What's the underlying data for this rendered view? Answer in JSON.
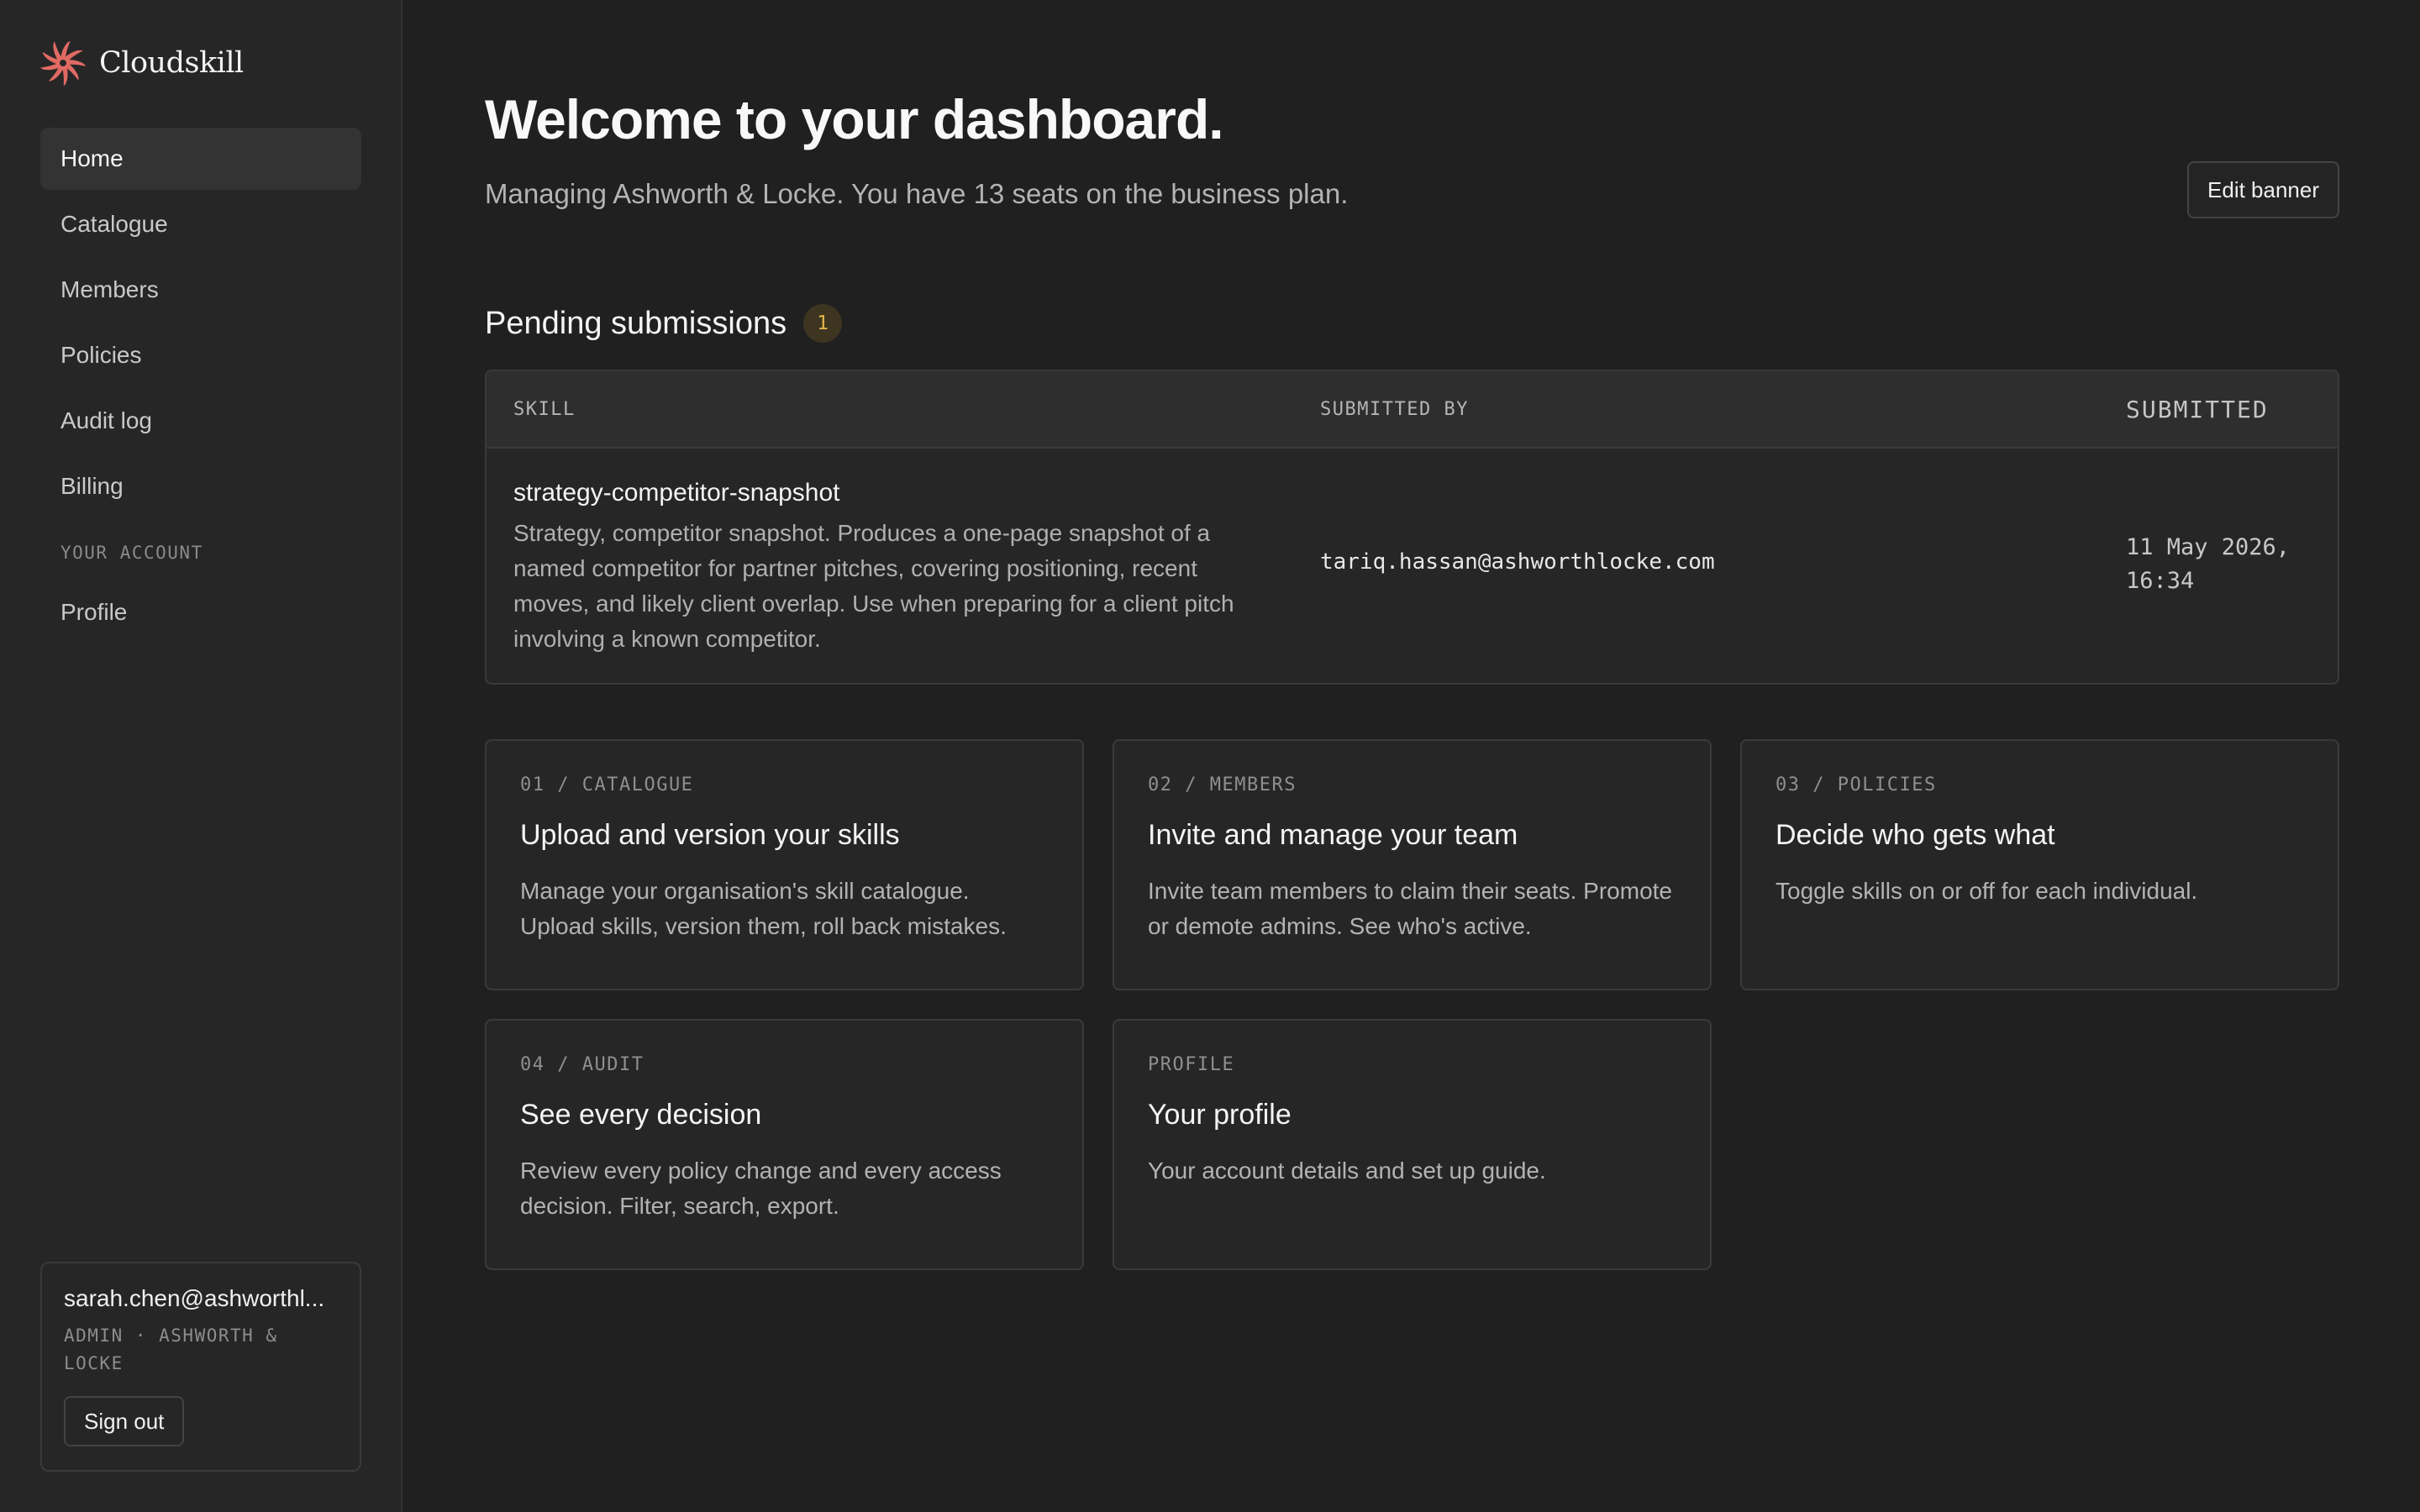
{
  "brand": {
    "name": "Cloudskill",
    "logo_icon": "cloudskill-logo-icon",
    "logo_color": "#e06a63"
  },
  "nav": {
    "items": [
      {
        "label": "Home",
        "active": true
      },
      {
        "label": "Catalogue"
      },
      {
        "label": "Members"
      },
      {
        "label": "Policies"
      },
      {
        "label": "Audit log"
      },
      {
        "label": "Billing"
      }
    ],
    "account_section_label": "YOUR ACCOUNT",
    "account_items": [
      {
        "label": "Profile"
      }
    ]
  },
  "account": {
    "email": "sarah.chen@ashworthl...",
    "role": "ADMIN · ASHWORTH & LOCKE",
    "sign_out_label": "Sign out"
  },
  "header": {
    "title": "Welcome to your dashboard.",
    "subtitle": "Managing Ashworth & Locke. You have 13 seats on the business plan.",
    "edit_banner_label": "Edit banner"
  },
  "pending": {
    "title": "Pending submissions",
    "count": "1",
    "columns": {
      "skill": "SKILL",
      "submitted_by": "SUBMITTED BY",
      "submitted": "SUBMITTED"
    },
    "rows": [
      {
        "skill": "strategy-competitor-snapshot",
        "description": "Strategy, competitor snapshot. Produces a one-page snapshot of a named competitor for partner pitches, covering positioning, recent moves, and likely client overlap. Use when preparing for a client pitch involving a known competitor.",
        "submitted_by": "tariq.hassan@ashworthlocke.com",
        "submitted": "11 May 2026, 16:34"
      }
    ]
  },
  "cards": [
    {
      "kicker": "01 / CATALOGUE",
      "title": "Upload and version your skills",
      "desc": "Manage your organisation's skill catalogue. Upload skills, version them, roll back mistakes."
    },
    {
      "kicker": "02 / MEMBERS",
      "title": "Invite and manage your team",
      "desc": "Invite team members to claim their seats. Promote or demote admins. See who's active."
    },
    {
      "kicker": "03 / POLICIES",
      "title": "Decide who gets what",
      "desc": "Toggle skills on or off for each individual."
    },
    {
      "kicker": "04 / AUDIT",
      "title": "See every decision",
      "desc": "Review every policy change and every access decision. Filter, search, export."
    },
    {
      "kicker": "PROFILE",
      "title": "Your profile",
      "desc": "Your account details and set up guide."
    }
  ]
}
